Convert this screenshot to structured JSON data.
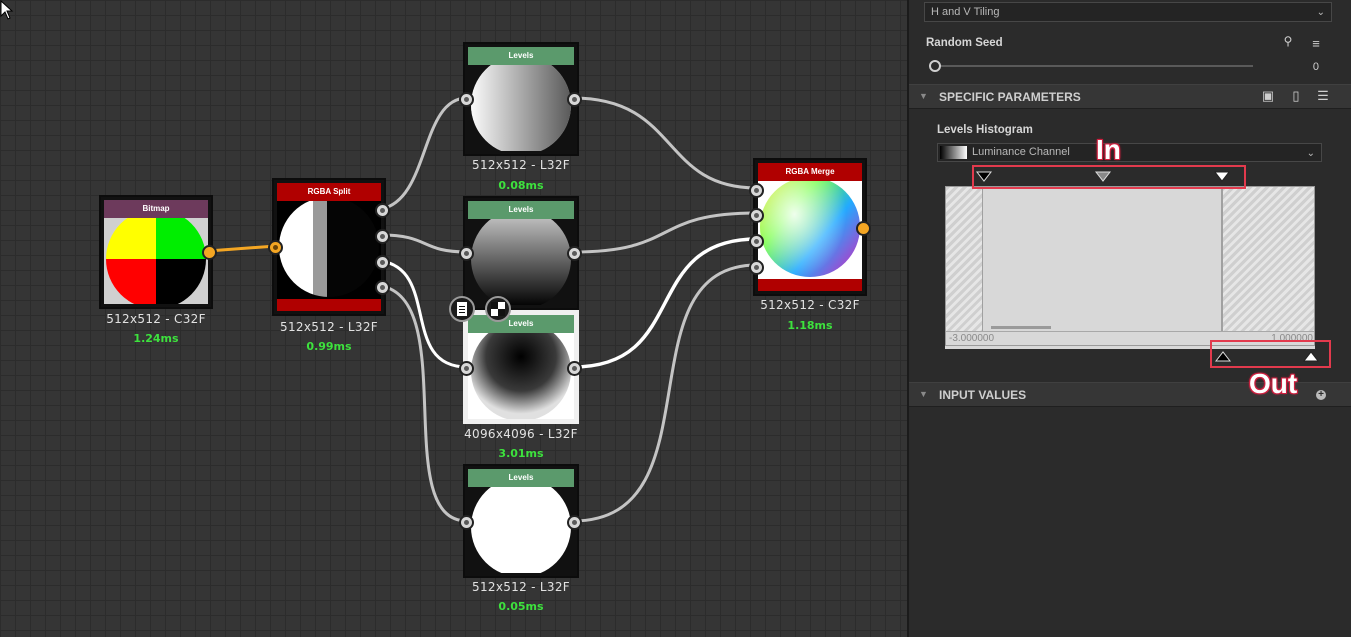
{
  "colors": {
    "accent_orange": "#f4a623",
    "time_green": "#3de23d",
    "levels_header": "#5b9a6c",
    "rgba_header": "#b00000",
    "bitmap_header": "#6d3a5c",
    "annotation_red": "#e23a4d"
  },
  "graph": {
    "nodes": {
      "bitmap": {
        "header": "Bitmap",
        "resolution": "512x512 - C32F",
        "time": "1.24ms"
      },
      "rgba_split": {
        "header": "RGBA Split",
        "resolution": "512x512 - L32F",
        "time": "0.99ms"
      },
      "levels_1": {
        "header": "Levels",
        "resolution": "512x512 - L32F",
        "time": "0.08ms"
      },
      "levels_2": {
        "header": "Levels"
      },
      "levels_3": {
        "header": "Levels",
        "resolution": "4096x4096 - L32F",
        "time": "3.01ms"
      },
      "levels_4": {
        "header": "Levels",
        "resolution": "512x512 - L32F",
        "time": "0.05ms"
      },
      "rgba_merge": {
        "header": "RGBA Merge",
        "resolution": "512x512 - C32F",
        "time": "1.18ms"
      }
    },
    "overlay_icons": [
      "document-icon",
      "checker-icon"
    ]
  },
  "panel": {
    "tiling_dropdown": {
      "value": "H and V Tiling"
    },
    "random_seed": {
      "label": "Random Seed",
      "value": "0",
      "slider_fraction": 0.0
    },
    "specific_parameters": {
      "title": "SPECIFIC PARAMETERS"
    },
    "levels_histogram": {
      "label": "Levels Histogram",
      "channel": "Luminance Channel",
      "axis_min": "-3.000000",
      "axis_max": "1.000000",
      "in_handles": [
        "black",
        "gray",
        "white"
      ],
      "out_handles": [
        "black",
        "white"
      ]
    },
    "input_values": {
      "title": "INPUT VALUES"
    }
  },
  "annotations": {
    "in_label": "In",
    "out_label": "Out"
  }
}
